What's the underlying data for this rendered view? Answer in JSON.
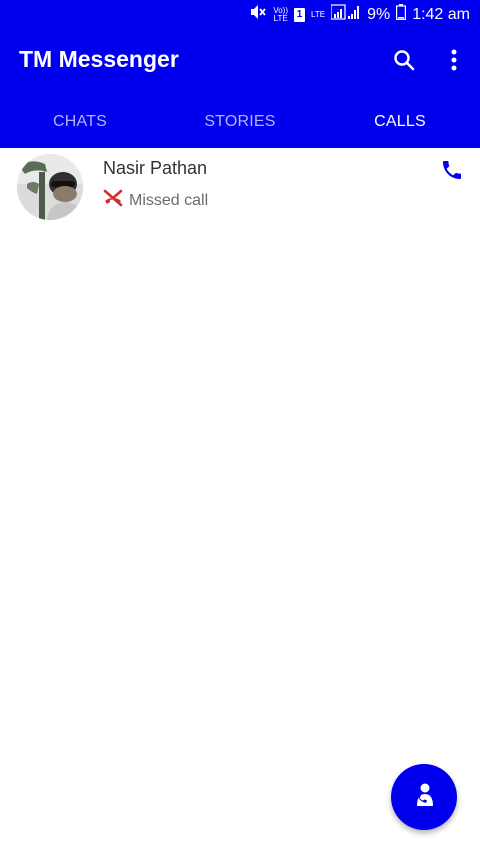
{
  "status_bar": {
    "volte_label": "Vo))\nLTE",
    "sim_label": "1",
    "lte_label": "LTE",
    "battery_percent": "9%",
    "time": "1:42 am"
  },
  "app": {
    "title": "TM Messenger",
    "accent_color": "#0000ee"
  },
  "tabs": [
    {
      "label": "CHATS",
      "active": false
    },
    {
      "label": "STORIES",
      "active": false
    },
    {
      "label": "CALLS",
      "active": true
    }
  ],
  "calls": [
    {
      "name": "Nasir Pathan",
      "status": "Missed call",
      "status_icon": "missed-call-icon",
      "status_color": "#d32f2f",
      "action_icon": "phone-icon"
    }
  ],
  "fab": {
    "icon": "contact-person-icon"
  }
}
